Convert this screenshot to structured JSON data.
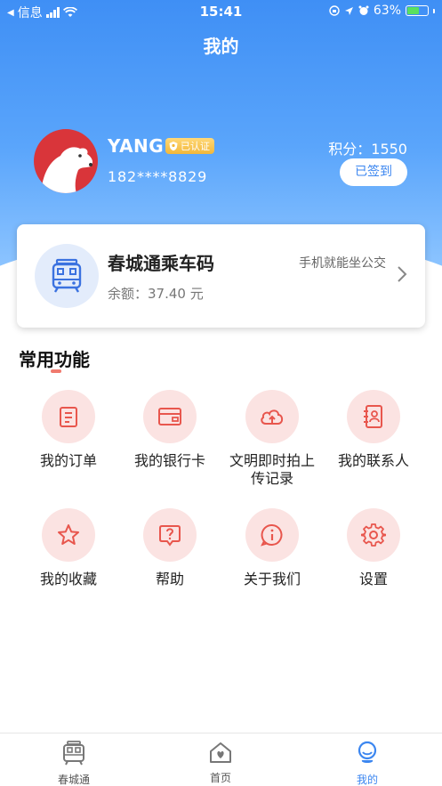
{
  "status_bar": {
    "back_label": "信息",
    "time": "15:41",
    "battery_percent": "63%",
    "battery_level": 0.63
  },
  "header": {
    "title": "我的"
  },
  "profile": {
    "name": "YANG",
    "verified_label": "已认证",
    "phone": "182****8829",
    "points": "积分：1550",
    "signed_button": "已签到"
  },
  "bus_card": {
    "title": "春城通乘车码",
    "balance": "余额：37.40 元",
    "slogan": "手机就能坐公交"
  },
  "functions": {
    "title": "常用功能",
    "items": [
      {
        "label": "我的订单",
        "icon": "order-icon"
      },
      {
        "label": "我的银行卡",
        "icon": "bank-card-icon"
      },
      {
        "label": "文明即时拍上传记录",
        "icon": "upload-cloud-icon"
      },
      {
        "label": "我的联系人",
        "icon": "contacts-icon"
      },
      {
        "label": "我的收藏",
        "icon": "star-icon"
      },
      {
        "label": "帮助",
        "icon": "help-icon"
      },
      {
        "label": "关于我们",
        "icon": "info-icon"
      },
      {
        "label": "设置",
        "icon": "gear-icon"
      }
    ]
  },
  "tabbar": {
    "tabs": [
      {
        "label": "春城通",
        "icon": "bus-icon"
      },
      {
        "label": "首页",
        "icon": "home-icon"
      },
      {
        "label": "我的",
        "icon": "mine-icon"
      }
    ],
    "active_index": 2
  },
  "colors": {
    "brand_blue": "#3b86f0",
    "icon_red": "#e8564d",
    "icon_bg": "#fbe3e2",
    "gold_badge": "#f2b73a"
  }
}
